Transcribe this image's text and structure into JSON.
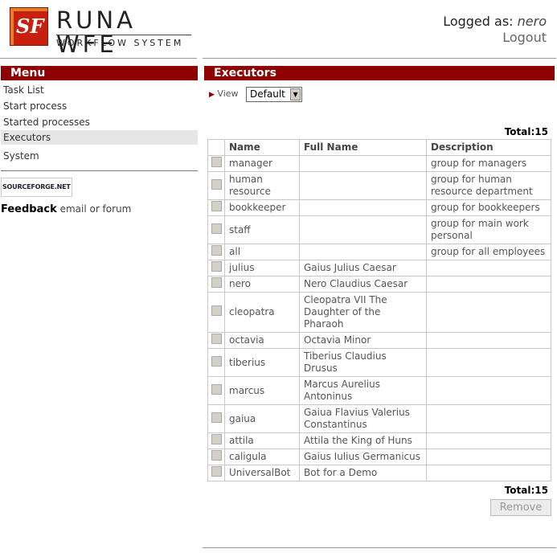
{
  "brand": {
    "logo_mark": "SF",
    "name": "RUNA WFE",
    "subtitle": "WORKFLOW SYSTEM"
  },
  "user": {
    "logged_as_label": "Logged as:",
    "name": "nero",
    "logout": "Logout"
  },
  "menu": {
    "title": "Menu",
    "items": [
      {
        "label": "Task List"
      },
      {
        "label": "Start process"
      },
      {
        "label": "Started processes"
      },
      {
        "label": "Executors",
        "active": true
      },
      {
        "label": "System"
      }
    ],
    "sourceforge": "SOURCEFORGE.NET",
    "feedback_label": "Feedback",
    "feedback_text": "email or forum"
  },
  "executors": {
    "title": "Executors",
    "view_label": "View",
    "view_value": "Default",
    "total_label": "Total:15",
    "columns": [
      "Name",
      "Full Name",
      "Description"
    ],
    "rows": [
      {
        "name": "manager",
        "full": "",
        "desc": "group for managers"
      },
      {
        "name": "human resource",
        "full": "",
        "desc": "group for human resource department"
      },
      {
        "name": "bookkeeper",
        "full": "",
        "desc": "group for bookkeepers"
      },
      {
        "name": "staff",
        "full": "",
        "desc": "group for main work personal"
      },
      {
        "name": "all",
        "full": "",
        "desc": "group for all employees"
      },
      {
        "name": "julius",
        "full": "Gaius Julius Caesar",
        "desc": ""
      },
      {
        "name": "nero",
        "full": "Nero Claudius Caesar",
        "desc": ""
      },
      {
        "name": "cleopatra",
        "full": "Cleopatra VII The Daughter of the Pharaoh",
        "desc": ""
      },
      {
        "name": "octavia",
        "full": "Octavia Minor",
        "desc": ""
      },
      {
        "name": "tiberius",
        "full": "Tiberius Claudius Drusus",
        "desc": ""
      },
      {
        "name": "marcus",
        "full": "Marcus Aurelius Antoninus",
        "desc": ""
      },
      {
        "name": "gaiua",
        "full": "Gaiua Flavius Valerius Constantinus",
        "desc": ""
      },
      {
        "name": "attila",
        "full": "Attila the King of Huns",
        "desc": ""
      },
      {
        "name": "caligula",
        "full": "Gaius Iulius Germanicus",
        "desc": ""
      },
      {
        "name": "UniversalBot",
        "full": "Bot for a Demo",
        "desc": ""
      }
    ],
    "remove_label": "Remove"
  }
}
